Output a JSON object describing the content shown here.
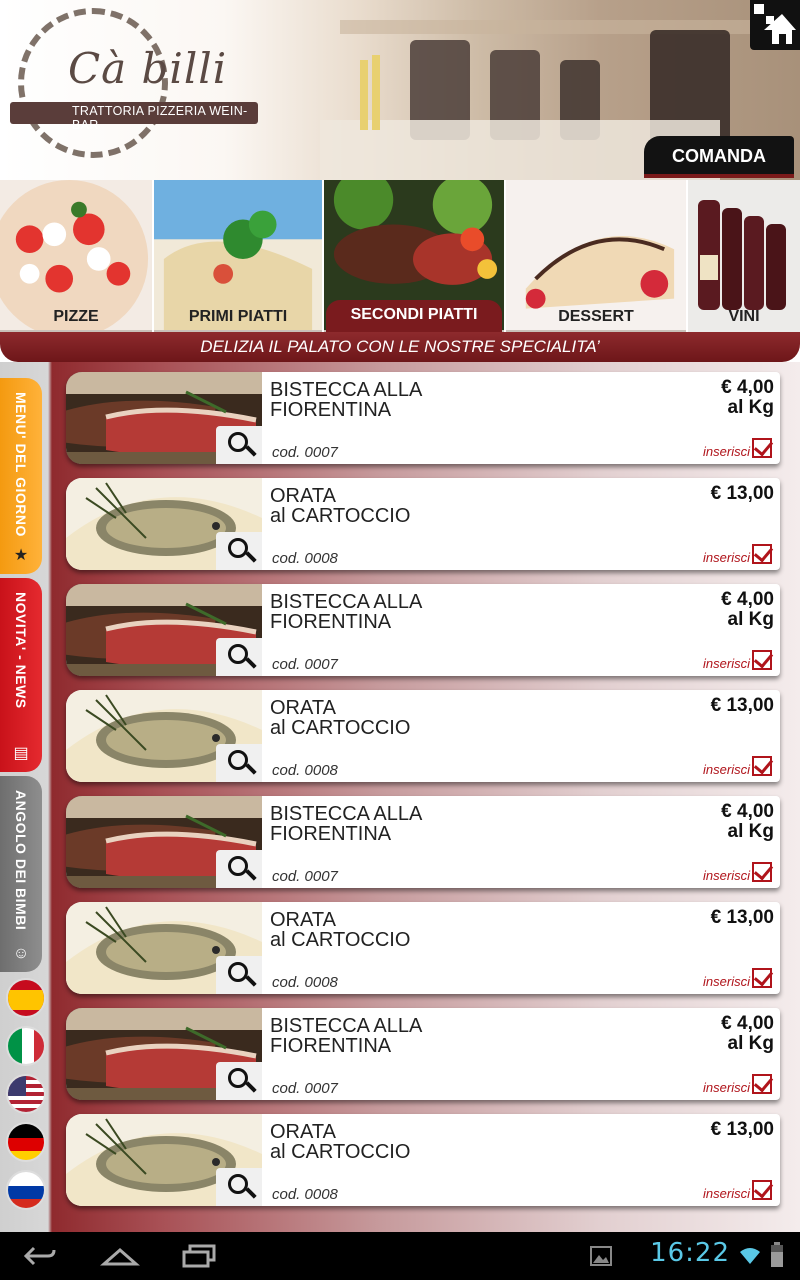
{
  "header": {
    "logo_name": "Cà billi",
    "logo_subtitle": "TRATTORIA PIZZERIA WEIN-BAR",
    "comanda_label": "COMANDA"
  },
  "categories": [
    {
      "label": "PIZZE",
      "active": false
    },
    {
      "label": "PRIMI PIATTI",
      "active": false
    },
    {
      "label": "SECONDI PIATTI",
      "active": true
    },
    {
      "label": "DESSERT",
      "active": false
    },
    {
      "label": "VINI",
      "active": false
    }
  ],
  "tagline": "DELIZIA IL PALATO CON LE NOSTRE SPECIALITA’",
  "sidebar": {
    "tabs": [
      {
        "label": "MENU' DEL GIORNO",
        "icon": "star-icon"
      },
      {
        "label": "NOVITA' - NEWS",
        "icon": "news-icon"
      },
      {
        "label": "ANGOLO DEI BIMBI",
        "icon": "smiley-icon"
      }
    ],
    "flags": [
      "spain-flag",
      "italy-flag",
      "usa-flag",
      "germany-flag",
      "russia-flag"
    ]
  },
  "items": [
    {
      "name_1": "BISTECCA ALLA",
      "name_2": "FIORENTINA",
      "code": "cod. 0007",
      "price_1": "€ 4,00",
      "price_2": "al Kg",
      "insert_label": "inserisci",
      "kind": "steak"
    },
    {
      "name_1": "ORATA",
      "name_2": "al CARTOCCIO",
      "code": "cod. 0008",
      "price_1": "€ 13,00",
      "price_2": "",
      "insert_label": "inserisci",
      "kind": "fish"
    },
    {
      "name_1": "BISTECCA ALLA",
      "name_2": "FIORENTINA",
      "code": "cod. 0007",
      "price_1": "€ 4,00",
      "price_2": "al Kg",
      "insert_label": "inserisci",
      "kind": "steak"
    },
    {
      "name_1": "ORATA",
      "name_2": "al CARTOCCIO",
      "code": "cod. 0008",
      "price_1": "€ 13,00",
      "price_2": "",
      "insert_label": "inserisci",
      "kind": "fish"
    },
    {
      "name_1": "BISTECCA ALLA",
      "name_2": "FIORENTINA",
      "code": "cod. 0007",
      "price_1": "€ 4,00",
      "price_2": "al Kg",
      "insert_label": "inserisci",
      "kind": "steak"
    },
    {
      "name_1": "ORATA",
      "name_2": "al CARTOCCIO",
      "code": "cod. 0008",
      "price_1": "€ 13,00",
      "price_2": "",
      "insert_label": "inserisci",
      "kind": "fish"
    },
    {
      "name_1": "BISTECCA ALLA",
      "name_2": "FIORENTINA",
      "code": "cod. 0007",
      "price_1": "€ 4,00",
      "price_2": "al Kg",
      "insert_label": "inserisci",
      "kind": "steak"
    },
    {
      "name_1": "ORATA",
      "name_2": "al CARTOCCIO",
      "code": "cod. 0008",
      "price_1": "€ 13,00",
      "price_2": "",
      "insert_label": "inserisci",
      "kind": "fish"
    }
  ],
  "statusbar": {
    "time": "16:22"
  }
}
